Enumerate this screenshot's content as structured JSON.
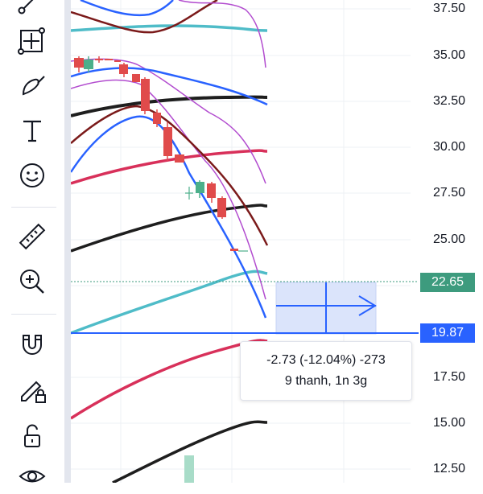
{
  "toolbar": {
    "tools": [
      {
        "name": "trend-line-tool-icon"
      },
      {
        "name": "fib-tool-icon"
      },
      {
        "name": "brush-tool-icon"
      },
      {
        "name": "text-tool-icon"
      },
      {
        "name": "emoji-tool-icon"
      },
      {
        "name": "ruler-tool-icon"
      },
      {
        "name": "zoom-in-tool-icon"
      },
      {
        "name": "magnet-tool-icon"
      },
      {
        "name": "lock-drawing-tool-icon"
      },
      {
        "name": "unlock-tool-icon"
      },
      {
        "name": "eye-tool-icon"
      }
    ]
  },
  "price_axis": {
    "ticks": [
      "37.50",
      "35.00",
      "32.50",
      "30.00",
      "27.50",
      "25.00",
      "17.50",
      "15.00",
      "12.50"
    ]
  },
  "price_tags": {
    "current": {
      "label": "22.65",
      "color": "#3d9b7e"
    },
    "measure": {
      "label": "19.87",
      "color": "#2962ff"
    }
  },
  "measure": {
    "change": "-2.73 (-12.04%) -273",
    "span": "9 thanh, 1n 3g"
  },
  "colors": {
    "up_candle": "#4caf8a",
    "down_candle": "#e04b4b",
    "blue_line": "#2962ff",
    "teal_line": "#4fbcc8",
    "black_line": "#1e1e1e",
    "pink_line": "#d8305a",
    "darkred_line": "#7b1a1a",
    "purple_line": "#b24ccf"
  }
}
